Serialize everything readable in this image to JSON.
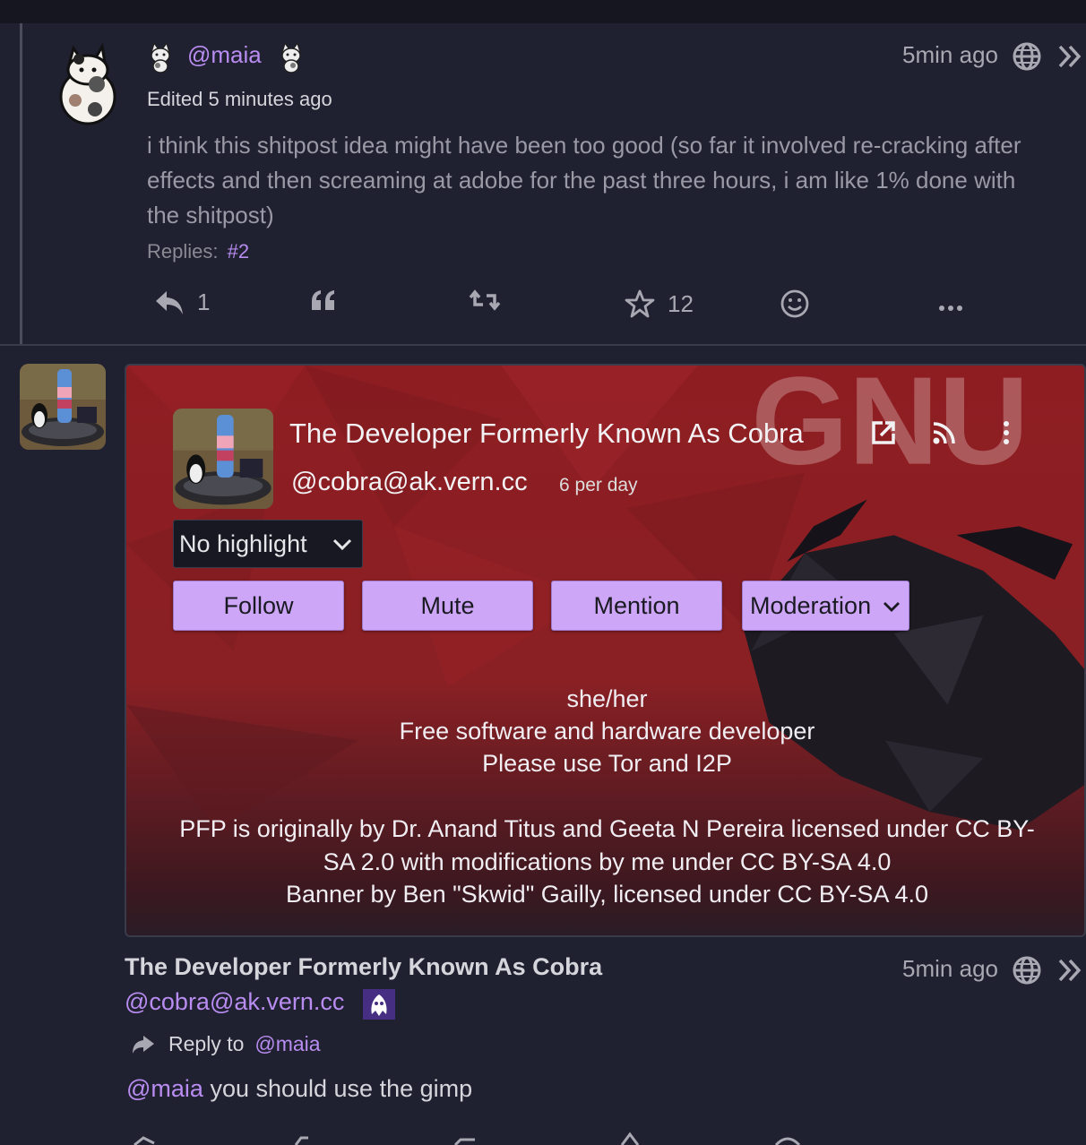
{
  "post1": {
    "handle": "@maia",
    "time": "5min ago",
    "edited": "Edited 5 minutes ago",
    "text": "i think this shitpost idea might have been too good (so far it involved re-cracking after effects and then screaming at adobe for the past three hours, i am like 1% done with the shitpost)",
    "replies_label": "Replies:",
    "replies_link": "#2",
    "actions": {
      "reply_count": "1",
      "fav_count": "12"
    }
  },
  "profile_card": {
    "display_name": "The Developer Formerly Known As Cobra",
    "handle": "@cobra@ak.vern.cc",
    "rate": "6 per day",
    "highlight": "No highlight",
    "buttons": {
      "follow": "Follow",
      "mute": "Mute",
      "mention": "Mention",
      "moderation": "Moderation"
    },
    "bio": {
      "line1": "she/her",
      "line2": "Free software and hardware developer",
      "line3": "Please use Tor and I2P",
      "line4": "PFP is originally by Dr. Anand Titus and Geeta N Pereira licensed under CC BY-",
      "line5": "SA 2.0 with modifications by me under CC BY-SA 4.0",
      "line6": "Banner by Ben \"Skwid\" Gailly, licensed under CC BY-SA 4.0"
    },
    "banner_word": "GNU"
  },
  "post2": {
    "display_name": "The Developer Formerly Known As Cobra",
    "handle": "@cobra@ak.vern.cc",
    "time": "5min ago",
    "reply_to_label": "Reply to",
    "reply_to_handle": "@maia",
    "mention": "@maia",
    "text": " you should use the gimp"
  },
  "colors": {
    "background": "#1f2030",
    "accent": "#b88cf0",
    "button": "#cda6f7",
    "banner_red": "#8e1d22"
  },
  "icons": [
    "reply-icon",
    "quote-icon",
    "retweet-icon",
    "star-icon",
    "emoji-icon",
    "more-icon",
    "globe-icon",
    "chevrons-right-icon",
    "external-link-icon",
    "rss-icon",
    "kebab-icon"
  ]
}
